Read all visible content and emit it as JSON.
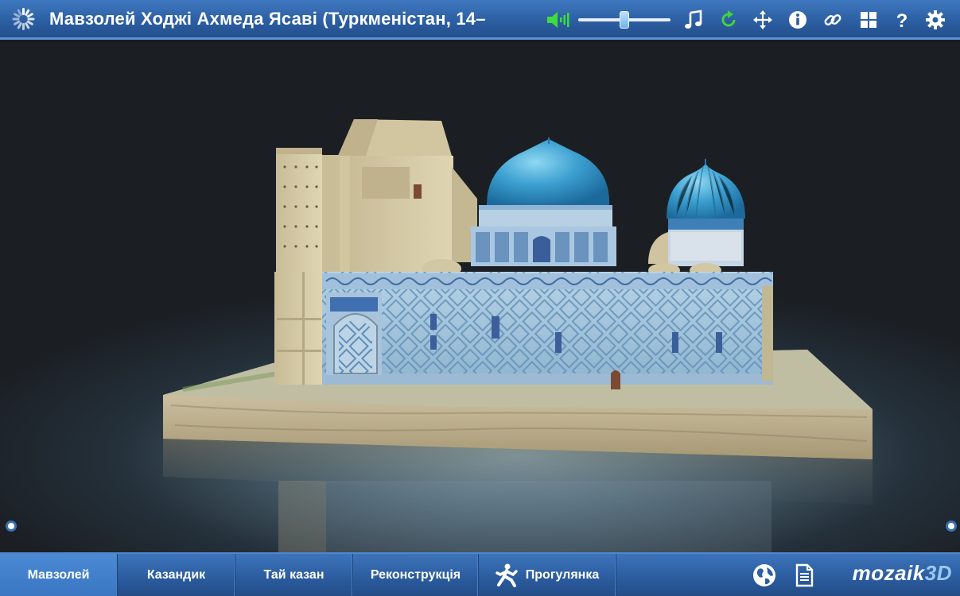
{
  "header": {
    "title": "Мавзолей Ходжі Ахмеда Ясаві (Туркменістан, 14–",
    "volume": 0.5,
    "icons": [
      "loading-icon",
      "speaker-icon",
      "music-icon",
      "reset-icon",
      "move-icon",
      "info-icon",
      "link-icon",
      "grid-icon",
      "help-icon",
      "settings-icon"
    ]
  },
  "bottom": {
    "tabs": [
      {
        "label": "Мавзолей",
        "active": true
      },
      {
        "label": "Казандик",
        "active": false
      },
      {
        "label": "Тай казан",
        "active": false
      },
      {
        "label": "Реконструкція",
        "active": false
      },
      {
        "label": "Прогулянка",
        "active": false,
        "icon": "walk-icon"
      }
    ],
    "icons": [
      "globe-icon",
      "document-icon"
    ],
    "brand": {
      "main": "mozaik",
      "suffix": "3D"
    }
  },
  "colors": {
    "bar": "#2c5fa3",
    "accent": "#5b93d6",
    "reset_green": "#43d13c",
    "speaker_green": "#3fdc3a",
    "dome_blue": "#3b9fd0"
  }
}
